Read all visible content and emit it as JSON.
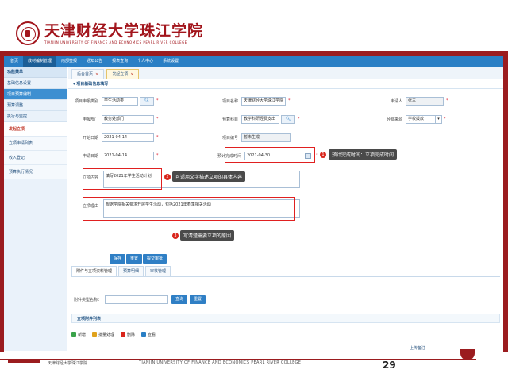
{
  "header": {
    "school_cn": "天津财经大学珠江学院",
    "school_en": "TIANJIN UNIVERSITY OF FINANCE AND ECONOMICS PEARL RIVER COLLEGE"
  },
  "nav": {
    "items": [
      {
        "label": "首页",
        "active": false
      },
      {
        "label": "教材编制管理",
        "active": true
      },
      {
        "label": "内部签报",
        "active": false
      },
      {
        "label": "通知公告",
        "active": false
      },
      {
        "label": "报表查询",
        "active": false
      },
      {
        "label": "个人中心",
        "active": false
      },
      {
        "label": "系统设置",
        "active": false
      }
    ]
  },
  "sidebar": {
    "title": "功能菜单",
    "groups": [
      {
        "label": "基础信息设置",
        "active": false
      },
      {
        "label": "项目预算编制",
        "active": true
      },
      {
        "label": "预算调整",
        "active": false
      },
      {
        "label": "执行与监控",
        "active": false
      }
    ],
    "subs": [
      {
        "label": "发起立项",
        "active": true
      },
      {
        "label": "立项申请列表",
        "active": false
      },
      {
        "label": "收入登记",
        "active": false
      },
      {
        "label": "预算执行情况",
        "active": false
      }
    ]
  },
  "tabs": [
    {
      "label": "后台首页",
      "active": false
    },
    {
      "label": "发起立项",
      "active": true
    }
  ],
  "form": {
    "section_title": "项目基础信息填写",
    "fields": {
      "project_type": {
        "label": "项目申报类别",
        "value": "学生活动类"
      },
      "project_name": {
        "label": "项目名称",
        "value": "天津财经大学珠江学院"
      },
      "applicant": {
        "label": "申请人",
        "value": "张三"
      },
      "dept": {
        "label": "申报部门",
        "value": "教务处部门"
      },
      "budget_subject": {
        "label": "预算科目",
        "value": "教学科研经费支出"
      },
      "fund_source": {
        "label": "经费来源",
        "value": "学校拨款"
      },
      "start_date": {
        "label": "开始日期",
        "value": "2021-04-14"
      },
      "project_code": {
        "label": "项目编号",
        "value": "暂未生成"
      },
      "apply_date": {
        "label": "申请日期",
        "value": "2021-04-14"
      },
      "expect_date": {
        "label": "预计完成时间",
        "value": "2021-04-30"
      }
    },
    "content": {
      "label": "立项内容",
      "value": "填写2021年学生活动计划"
    },
    "reason": {
      "label": "立项理由",
      "value": "根据学院相关要求开展学生活动，包括2021年春季相关活动"
    },
    "buttons": {
      "save": "保存",
      "reset": "重置",
      "submit": "提交审批"
    }
  },
  "annotations": {
    "a1": {
      "num": "1",
      "text": "预计完成时间：立项完成时间"
    },
    "a2": {
      "num": "2",
      "text": "可适用文字描述立项的具体内容"
    },
    "a3": {
      "num": "3",
      "text": "写清楚需要立项的原因"
    }
  },
  "subtabs": [
    {
      "label": "附件与立项资料管理",
      "active": true
    },
    {
      "label": "预算明细",
      "active": false
    },
    {
      "label": "审核管理",
      "active": false
    }
  ],
  "filter": {
    "label": "附件类型名称：",
    "search": "查询",
    "reset": "重置"
  },
  "list_section": "立项附件列表",
  "toolbar": {
    "add": "新增",
    "batch": "批量处理",
    "delete": "删除",
    "view": "查看"
  },
  "table_hint": "上传备注",
  "footer": {
    "left": "天津财经大学珠江学院",
    "mid": "TIANJIN UNIVERSITY OF FINANCE AND ECONOMICS PEARL RIVER COLLEGE",
    "page": "29"
  },
  "colors": {
    "brand_red": "#9b1c1f",
    "nav_blue": "#2a7fc5",
    "annot_red": "#d9251b"
  }
}
